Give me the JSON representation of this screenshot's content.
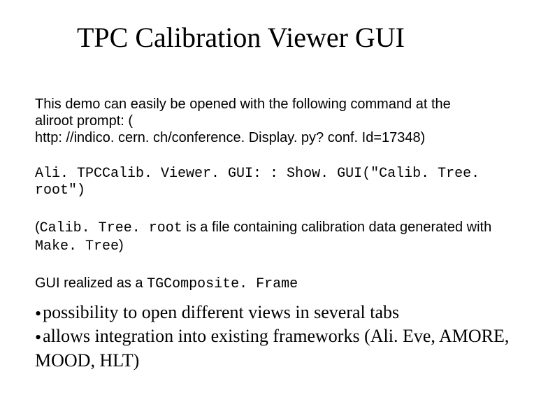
{
  "title": "TPC Calibration Viewer GUI",
  "intro": {
    "line1": "This demo can easily be opened with the following command at the",
    "line2": "aliroot prompt: (",
    "line3": "http: //indico. cern. ch/conference. Display. py? conf. Id=17348)"
  },
  "command": "Ali. TPCCalib. Viewer. GUI: : Show. GUI(\"Calib. Tree. root\")",
  "note": {
    "prefix": "(",
    "filename": "Calib. Tree. root",
    "mid": " is a file containing calibration data generated with ",
    "maketree": "Make. Tree",
    "suffix": ")"
  },
  "gui_line": {
    "prefix": "GUI realized as a ",
    "classname": "TGComposite. Frame"
  },
  "bullets": [
    "possibility to open different views in several tabs",
    "allows integration into existing frameworks (Ali. Eve, AMORE, MOOD, HLT)"
  ]
}
